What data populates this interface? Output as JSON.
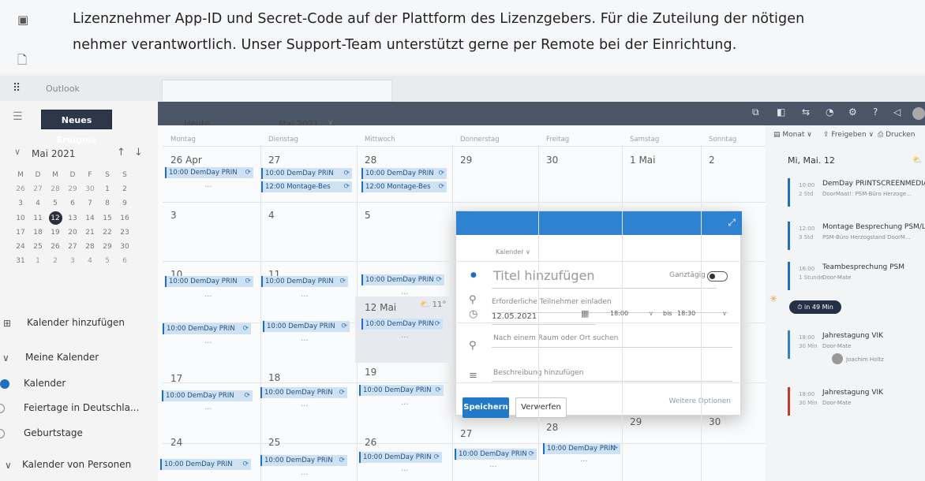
{
  "overlay": {
    "line1": "Lizenznehmer App-ID und Secret-Code auf der Plattform des Lizenzgebers. Für die Zuteilung der nötigen",
    "line2": "nehmer verantwortlich. Unser Support-Team unterstützt gerne per Remote bei der Einrichtung."
  },
  "header": {
    "app_name": "Outlook"
  },
  "left": {
    "new_event": "Neues Ereignis",
    "mini_month": "Mai 2021",
    "weekdays": [
      "M",
      "D",
      "M",
      "D",
      "F",
      "S",
      "S"
    ],
    "weeks": [
      [
        "26",
        "27",
        "28",
        "29",
        "30",
        "1",
        "2"
      ],
      [
        "3",
        "4",
        "5",
        "6",
        "7",
        "8",
        "9"
      ],
      [
        "10",
        "11",
        "12",
        "13",
        "14",
        "15",
        "16"
      ],
      [
        "17",
        "18",
        "19",
        "20",
        "21",
        "22",
        "23"
      ],
      [
        "24",
        "25",
        "26",
        "27",
        "28",
        "29",
        "30"
      ],
      [
        "31",
        "1",
        "2",
        "3",
        "4",
        "5",
        "6"
      ]
    ],
    "today": "12",
    "add_calendar": "Kalender hinzufügen",
    "my_calendars": "Meine Kalender",
    "calendars": [
      {
        "label": "Kalender",
        "checked": true
      },
      {
        "label": "Feiertage in Deutschla...",
        "checked": false
      },
      {
        "label": "Geburtstage",
        "checked": false
      }
    ],
    "people_calendars": "Kalender von Personen"
  },
  "toolbar": {
    "today": "Heute",
    "month": "Mai 2021"
  },
  "grid": {
    "days": [
      "Montag",
      "Dienstag",
      "Mittwoch",
      "Donnerstag",
      "Freitag",
      "Samstag",
      "Sonntag"
    ],
    "weeks": [
      [
        "26 Apr",
        "27",
        "28",
        "29",
        "30",
        "1 Mai",
        "2"
      ],
      [
        "3",
        "4",
        "5",
        "",
        "",
        "",
        ""
      ],
      [
        "10",
        "11",
        "12 Mai",
        "",
        "",
        "",
        ""
      ],
      [
        "17",
        "18",
        "19",
        "",
        "",
        "",
        ""
      ],
      [
        "24",
        "25",
        "26",
        "27",
        "28",
        "29",
        "30"
      ]
    ],
    "ev_prins": "10:00 DemDay PRIN",
    "ev_montage": "12:00 Montage-Bes",
    "more_dots": "···",
    "weather": "11°"
  },
  "right": {
    "month_btn": "Monat",
    "share_btn": "Freigeben",
    "print_btn": "Drucken",
    "agenda_title": "Mi, Mai. 12",
    "items": [
      {
        "time": "10:00",
        "dur": "2 Std",
        "title": "DemDay PRINTSCREENMEDIA",
        "sub": "DoorMaat!: PSM-Büro Herzoge...",
        "color": "#1e6fbf"
      },
      {
        "time": "12:00",
        "dur": "3 Std",
        "title": "Montage Besprechung PSM/L...",
        "sub": "PSM-Büro Herzogstand DoorM...",
        "color": "#1e6fbf"
      },
      {
        "time": "16:00",
        "dur": "1 Stunde",
        "title": "Teambesprechung PSM",
        "sub": "Door-Mate",
        "color": "#1e6fbf"
      },
      {
        "time": "18:00",
        "dur": "30 Min",
        "title": "Jahrestagung VIK",
        "sub": "Door-Mate",
        "color": "#2e82d0"
      },
      {
        "time": "18:00",
        "dur": "30 Min",
        "title": "Jahrestagung VIK",
        "sub": "Door-Mate",
        "color": "#c0392b"
      }
    ],
    "badge": "in 49 Min",
    "attendee": "Joachim Holtz"
  },
  "popup": {
    "calendar_label": "Kalender",
    "title_placeholder": "Titel hinzufügen",
    "allday": "Ganztägig",
    "attendees": "Erforderliche Teilnehmer einladen",
    "date": "12.05.2021",
    "start": "18:00",
    "bis": "bis",
    "end": "18:30",
    "location": "Nach einem Raum oder Ort suchen",
    "description": "Beschreibung hinzufügen",
    "save": "Speichern",
    "discard": "Verwerfen",
    "more_options": "Weitere Optionen"
  }
}
